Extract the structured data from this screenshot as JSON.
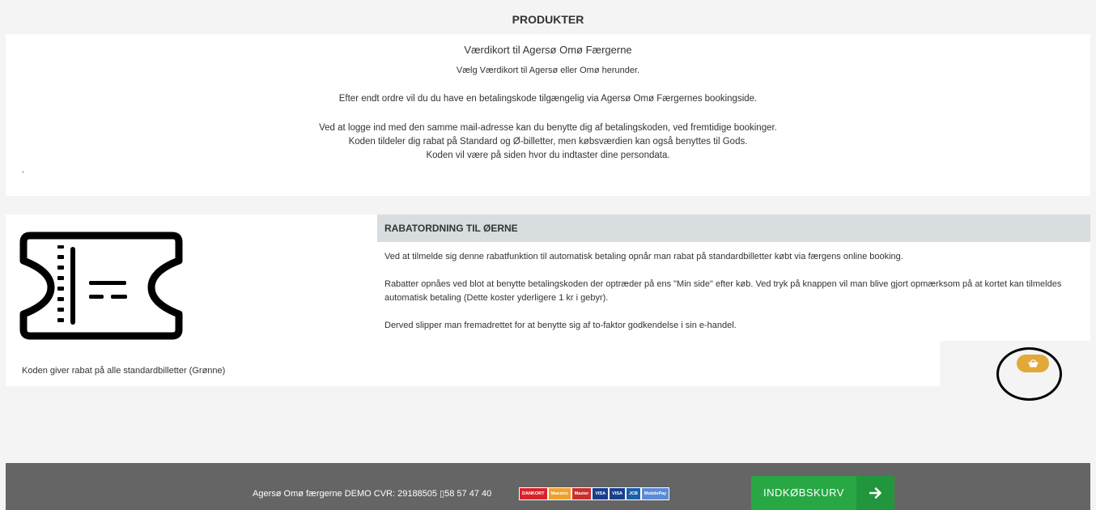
{
  "header": {
    "title": "PRODUKTER"
  },
  "intro": {
    "heading": "Værdikort til Agersø Omø Færgerne",
    "subheading": "Vælg Værdikort til Agersø eller Omø herunder.",
    "line1": "Efter endt ordre vil du du have en betalingskode tilgængelig via Agersø Omø Færgernes bookingside.",
    "line2": "Ved at logge ind med den samme mail-adresse kan du benytte dig af betalingskoden, ved fremtidige bookinger.",
    "line3": "Koden tildeler dig rabat på Standard og Ø-billetter, men købsværdien kan også benyttes til Gods.",
    "line4": "Koden vil være på siden hvor du indtaster dine persondata.",
    "stray": "."
  },
  "product": {
    "image_icon": "ticket-icon",
    "caption": "Koden giver rabat på alle standardbilletter (Grønne)",
    "title": "RABATORDNING TIL ØERNE",
    "para1": "Ved at tilmelde sig denne rabatfunktion til automatisk betaling opnår man rabat på standardbilletter købt via færgens online booking.",
    "para2": "Rabatter opnåes ved blot at benytte betalingskoden der optræder på ens \"Min side\" efter køb. Ved tryk på knappen vil man blive gjort opmærksom på at kortet kan tilmeldes automatisk betaling (Dette koster yderligere 1 kr i gebyr).",
    "para3": "Derved slipper man fremadrettet for at benytte sig af to-faktor godkendelse i sin e-handel.",
    "cart_icon": "basket-icon",
    "cart_color": "#e2a93a"
  },
  "footer": {
    "company": "Agersø Omø færgerne DEMO  CVR: 29188505 ▯58 57 47 40",
    "payment_logos": [
      "DANKORT",
      "Maestro",
      "Master",
      "VISA",
      "VISA",
      "JCB",
      "MobilePay"
    ],
    "checkout_label": "INDKØBSKURV",
    "checkout_icon": "arrow-right-icon",
    "checkout_color": "#28a745"
  }
}
